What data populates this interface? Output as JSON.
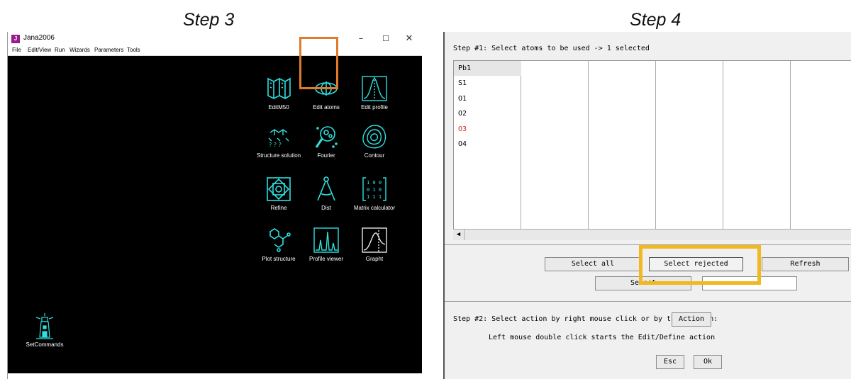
{
  "captions": {
    "step3": "Step 3",
    "step4": "Step 4"
  },
  "jana": {
    "window_title": "Jana2006",
    "app_logo": "J",
    "window_controls": {
      "minimize": "–",
      "maximize": "☐",
      "close": "✕"
    },
    "menu": [
      "File",
      "Edit/View",
      "Run",
      "Wizards",
      "Parameters",
      "Tools"
    ],
    "icons": [
      {
        "name": "editm50",
        "label": "EditM50"
      },
      {
        "name": "edit-atoms",
        "label": "Edit atoms"
      },
      {
        "name": "edit-profile",
        "label": "Edit profile"
      },
      {
        "name": "structure-solution",
        "label": "Structure solution"
      },
      {
        "name": "fourier",
        "label": "Fourier"
      },
      {
        "name": "contour",
        "label": "Contour"
      },
      {
        "name": "refine",
        "label": "Refine"
      },
      {
        "name": "dist",
        "label": "Dist"
      },
      {
        "name": "matrix-calculator",
        "label": "Matrix calculator"
      },
      {
        "name": "plot-structure",
        "label": "Plot structure"
      },
      {
        "name": "profile-viewer",
        "label": "Profile viewer"
      },
      {
        "name": "grapht",
        "label": "Grapht"
      },
      {
        "name": "setcommands",
        "label": "SetCommands"
      }
    ],
    "highlight_color": "#e07b2c"
  },
  "dialog": {
    "step1_text": "Step #1: Select atoms to be used  -> 1 selected",
    "atoms": [
      {
        "name": "Pb1",
        "color": "#000000"
      },
      {
        "name": "S1",
        "color": "#000000"
      },
      {
        "name": "O1",
        "color": "#000000"
      },
      {
        "name": "O2",
        "color": "#000000"
      },
      {
        "name": "O3",
        "color": "#e02020"
      },
      {
        "name": "O4",
        "color": "#000000"
      }
    ],
    "buttons": {
      "select_all": "Select all",
      "select_rejected": "Select rejected",
      "refresh": "Refresh",
      "select": "Select",
      "action": "Action",
      "esc": "Esc",
      "ok": "Ok"
    },
    "step2_text": "Step #2: Select action by right mouse click or by this button:",
    "hint_text": "Left mouse double click starts the Edit/Define action",
    "highlight_color": "#f2b81f"
  }
}
